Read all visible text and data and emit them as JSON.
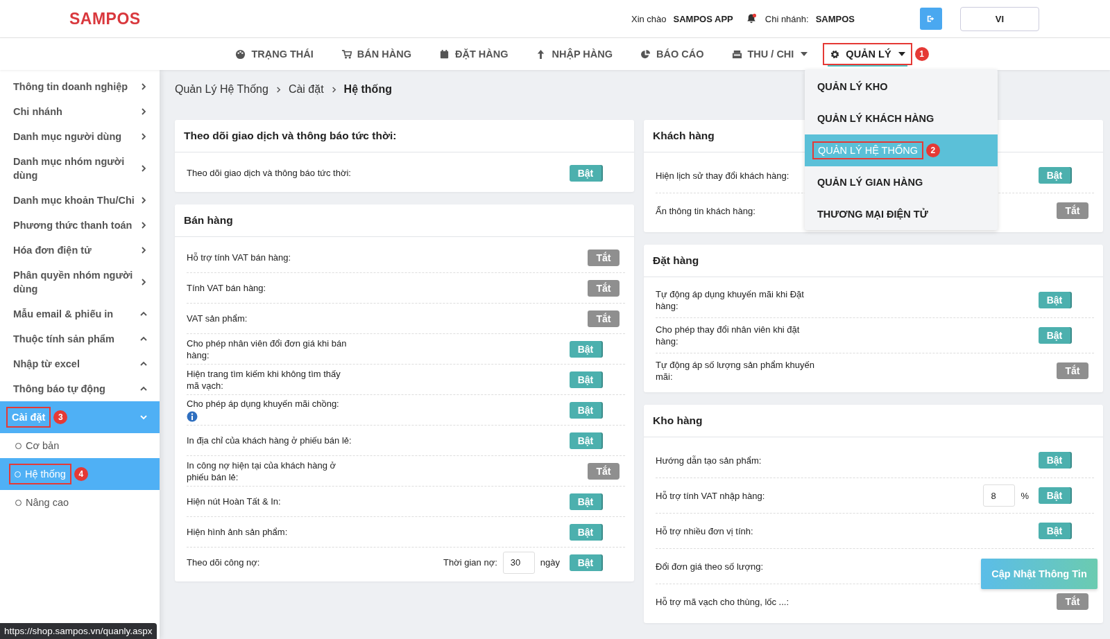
{
  "header": {
    "logo": "SAMPOS",
    "greeting": "Xin chào",
    "user": "SAMPOS APP",
    "branch_label": "Chi nhánh:",
    "branch": "SAMPOS",
    "language": "VI"
  },
  "nav": [
    {
      "label": "TRẠNG THÁI",
      "selected": false
    },
    {
      "label": "BÁN HÀNG",
      "selected": false
    },
    {
      "label": "ĐẶT HÀNG",
      "selected": false
    },
    {
      "label": "NHẬP HÀNG",
      "selected": false
    },
    {
      "label": "BÁO CÁO",
      "selected": false
    },
    {
      "label": "THU / CHI",
      "selected": false,
      "dropdown": true
    },
    {
      "label": "QUẢN LÝ",
      "selected": true,
      "dropdown": true,
      "marker": "1"
    }
  ],
  "menu": [
    {
      "label": "QUẢN LÝ KHO",
      "selected": false
    },
    {
      "label": "QUẢN LÝ KHÁCH HÀNG",
      "selected": false
    },
    {
      "label": "QUẢN LÝ HỆ THỐNG",
      "selected": true,
      "marker": "2"
    },
    {
      "label": "QUẢN LÝ GIAN HÀNG",
      "selected": false
    },
    {
      "label": "THƯƠNG MẠI ĐIỆN TỬ",
      "selected": false
    }
  ],
  "sidebar": [
    {
      "label": "Thông tin doanh nghiệp",
      "kind": "right",
      "selected": false
    },
    {
      "label": "Chi nhánh",
      "kind": "right",
      "selected": false
    },
    {
      "label": "Danh mục người dùng",
      "kind": "right",
      "selected": false
    },
    {
      "label": "Danh mục nhóm người dùng",
      "kind": "right",
      "selected": false
    },
    {
      "label": "Danh mục khoản Thu/Chi",
      "kind": "right",
      "selected": false
    },
    {
      "label": "Phương thức thanh toán",
      "kind": "right",
      "selected": false
    },
    {
      "label": "Hóa đơn điện tử",
      "kind": "right",
      "selected": false
    },
    {
      "label": "Phân quyền nhóm người dùng",
      "kind": "right",
      "selected": false
    },
    {
      "label": "Mẫu email & phiếu in",
      "kind": "up",
      "selected": false
    },
    {
      "label": "Thuộc tính sản phẩm",
      "kind": "up",
      "selected": false
    },
    {
      "label": "Nhập từ excel",
      "kind": "up",
      "selected": false
    },
    {
      "label": "Thông báo tự động",
      "kind": "up",
      "selected": false
    },
    {
      "label": "Cài đặt",
      "kind": "down",
      "selected": true,
      "marker": "3",
      "children": [
        {
          "label": "Cơ bản",
          "selected": false
        },
        {
          "label": "Hệ thống",
          "selected": true,
          "marker": "4"
        },
        {
          "label": "Nâng cao",
          "selected": false
        }
      ]
    }
  ],
  "breadcrumb": [
    "Quản Lý Hệ Thống",
    "Cài đặt",
    "Hệ thống"
  ],
  "columns": [
    [
      {
        "title": "Theo dõi giao dịch và thông báo tức thời:",
        "rows": [
          {
            "label": "Theo dõi giao dịch và thông báo tức thời:",
            "toggle": "Bật",
            "on": true
          }
        ]
      },
      {
        "title": "Bán hàng",
        "rows": [
          {
            "label": "Hỗ trợ tính VAT bán hàng:",
            "toggle": "Tắt",
            "on": false
          },
          {
            "label": "Tính VAT bán hàng:",
            "toggle": "Tắt",
            "on": false
          },
          {
            "label": "VAT sản phẩm:",
            "toggle": "Tắt",
            "on": false
          },
          {
            "label": "Cho phép nhân viên đổi đơn giá khi bán hàng:",
            "toggle": "Bật",
            "on": true
          },
          {
            "label": "Hiện trang tìm kiếm khi không tìm thấy mã vạch:",
            "toggle": "Bật",
            "on": true
          },
          {
            "label": "Cho phép áp dụng khuyến mãi chồng:",
            "info": true,
            "toggle": "Bật",
            "on": true
          },
          {
            "label": "In địa chỉ của khách hàng ở phiếu bán lẻ:",
            "toggle": "Bật",
            "on": true
          },
          {
            "label": "In công nợ hiện tại của khách hàng ở phiếu bán lẻ:",
            "toggle": "Tắt",
            "on": false
          },
          {
            "label": "Hiện nút Hoàn Tất & In:",
            "toggle": "Bật",
            "on": true
          },
          {
            "label": "Hiện hình ảnh sản phẩm:",
            "toggle": "Bật",
            "on": true
          },
          {
            "label": "Theo dõi công nợ:",
            "extra": {
              "prefix": "Thời gian nợ:",
              "value": "30",
              "suffix": "ngày"
            },
            "toggle": "Bật",
            "on": true
          }
        ]
      }
    ],
    [
      {
        "title": "Khách hàng",
        "rows": [
          {
            "label": "Hiện lịch sử thay đổi khách hàng:",
            "toggle": "Bật",
            "on": true
          },
          {
            "label": "Ẩn thông tin khách hàng:",
            "toggle": "Tắt",
            "on": false
          }
        ]
      },
      {
        "title": "Đặt hàng",
        "rows": [
          {
            "label": "Tự động áp dụng khuyến mãi khi Đặt hàng:",
            "toggle": "Bật",
            "on": true
          },
          {
            "label": "Cho phép thay đổi nhân viên khi đặt hàng:",
            "toggle": "Bật",
            "on": true
          },
          {
            "label": "Tự động áp số lượng sản phẩm khuyến mãi:",
            "toggle": "Tắt",
            "on": false
          }
        ]
      },
      {
        "title": "Kho hàng",
        "rows": [
          {
            "label": "Hướng dẫn tạo sản phẩm:",
            "toggle": "Bật",
            "on": true
          },
          {
            "label": "Hỗ trợ tính VAT nhập hàng:",
            "extra": {
              "value": "8",
              "suffix": "%"
            },
            "toggle": "Bật",
            "on": true
          },
          {
            "label": "Hỗ trợ nhiều đơn vị tính:",
            "toggle": "Bật",
            "on": true
          },
          {
            "label": "Đổi đơn giá theo số lượng:"
          },
          {
            "label": "Hỗ trợ mã vạch cho thùng, lốc ...:",
            "toggle": "Tắt",
            "on": false
          }
        ]
      }
    ]
  ],
  "update_button": "Cập Nhật Thông Tin",
  "status_url": "https://shop.sampos.vn/quanly.aspx"
}
